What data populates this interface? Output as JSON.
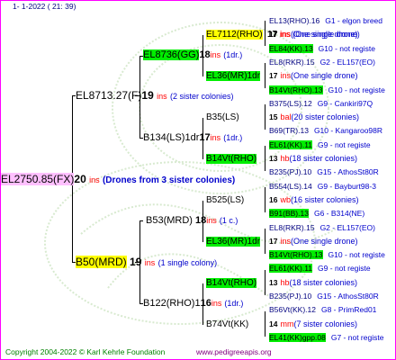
{
  "header": {
    "text": "1-   1-2022 (  21:  39)"
  },
  "footer": {
    "copyright": "Copyright 2004-2022 © Karl Kehrle Foundation",
    "site": "www.pedigreeapis.org"
  },
  "colors": {
    "frame": "#ff00ff",
    "yellow": "#ffff00",
    "green": "#00ee00",
    "pink": "#ffc0ff",
    "red": "#ff0000",
    "navy": "#000080",
    "blue": "#0000cc"
  },
  "root": {
    "name": "EL2750.85(FX)",
    "num": "20",
    "ins": "ins",
    "comment": "(Drones from 3 sister colonies)"
  },
  "gen1": [
    {
      "name": "EL8713.27(F)",
      "num": "19",
      "ins": "ins",
      "comment": "(2 sister colonies)"
    },
    {
      "name": "B50(MRD)",
      "num": "19",
      "ins": "ins",
      "comment": "(1 single colony)"
    }
  ],
  "gen2": [
    {
      "name": "EL8736(GG)",
      "num": "18",
      "ins": "ins",
      "comment": "(1dr.)"
    },
    {
      "name": "B134(LS)1dr",
      "num": "17",
      "ins": "ins",
      "comment": "(1dr.)"
    },
    {
      "name": "B53(MRD)",
      "num": "18",
      "ins": "ins",
      "comment": "(1 c.)"
    },
    {
      "name": "B122(RHO)1",
      "num": "16",
      "ins": "ins",
      "comment": "(1dr.)"
    }
  ],
  "gen3": [
    {
      "name": "EL7112(RHO)",
      "num": "17",
      "ins": "ins",
      "comment": "(One single drone)"
    },
    {
      "name": "EL36(MR)1dr",
      "num": "",
      "ins": "",
      "comment": ""
    },
    {
      "name": "B35(LS)",
      "num": "",
      "ins": "",
      "comment": ""
    },
    {
      "name": "B14Vt(RHO)",
      "num": "",
      "ins": "",
      "comment": ""
    },
    {
      "name": "B525(LS)",
      "num": "",
      "ins": "",
      "comment": ""
    },
    {
      "name": "EL36(MR)1dr",
      "num": "",
      "ins": "",
      "comment": ""
    },
    {
      "name": "B14Vt(RHO)",
      "num": "",
      "ins": "",
      "comment": ""
    },
    {
      "name": "B74Vt(KK)",
      "num": "",
      "ins": "",
      "comment": ""
    }
  ],
  "gen4": [
    {
      "a": "EL13(RHO).16",
      "b": "G1 - elgon breed"
    },
    {
      "a": "17",
      "ins": "ins",
      "c": "(One single drone)"
    },
    {
      "a": "EL84(KK).13",
      "b": "G10 - not registe"
    },
    {
      "a": "EL8(RKR).15",
      "b": "G2 - EL157(EO)"
    },
    {
      "a": "17",
      "ins": "ins",
      "c": "(One single drone)"
    },
    {
      "a": "B14Vt(RHO).13",
      "b": "G10 - not registe"
    },
    {
      "a": "B375(LS).12",
      "b": "G9 - Cankiri97Q"
    },
    {
      "a": "15",
      "ins": "bal",
      "c": "(20 sister colonies)"
    },
    {
      "a": "B69(TR).13",
      "b": "G10 - Kangaroo98R"
    },
    {
      "a": "EL61(KK).11",
      "b": "G9 - not registe"
    },
    {
      "a": "13",
      "ins": "hb",
      "c": "(18 sister colonies)"
    },
    {
      "a": "B235(PJ).10",
      "b": "G15 - AthosSt80R"
    },
    {
      "a": "B554(LS).14",
      "b": "G9 - Bayburt98-3"
    },
    {
      "a": "16",
      "ins": "wb",
      "c": "(16 sister colonies)"
    },
    {
      "a": "B91(BB).13",
      "b": "G6 - B314(NE)"
    },
    {
      "a": "EL8(RKR).15",
      "b": "G2 - EL157(EO)"
    },
    {
      "a": "17",
      "ins": "ins",
      "c": "(One single drone)"
    },
    {
      "a": "B14Vt(RHO).13",
      "b": "G10 - not registe"
    },
    {
      "a": "EL61(KK).11",
      "b": "G9 - not registe"
    },
    {
      "a": "13",
      "ins": "hb",
      "c": "(18 sister colonies)"
    },
    {
      "a": "B235(PJ).10",
      "b": "G15 - AthosSt80R"
    },
    {
      "a": "B56Vt(KK).12",
      "b": "G8 - PrimRed01"
    },
    {
      "a": "14",
      "ins": "mm",
      "c": "(7 sister colonies)"
    },
    {
      "a": "EL41(KK)gpp.08",
      "b": "G7 - not registe"
    }
  ]
}
